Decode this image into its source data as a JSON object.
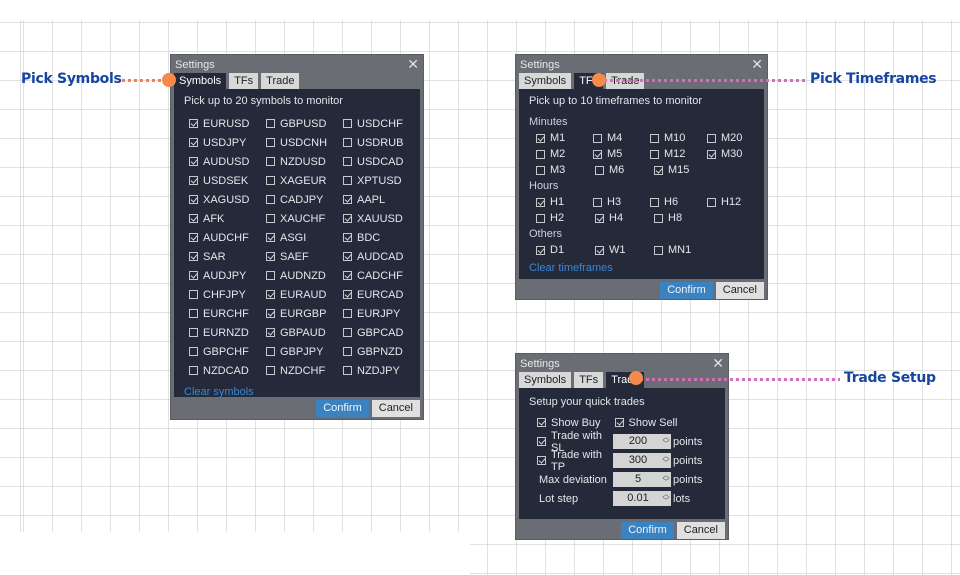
{
  "callouts": {
    "symbols": "Pick Symbols",
    "timeframes": "Pick Timeframes",
    "trade": "Trade Setup"
  },
  "colors": {
    "callout_text": "#1646a0",
    "dot": "#f58a4a",
    "symbols_line": "#f0805a",
    "timeframes_line": "#d070b8",
    "trade_line": "#d070b8",
    "confirm_bg": "#3b82c0",
    "panel_bg": "#242a3a"
  },
  "dialog": {
    "title": "Settings",
    "close_icon": "close-icon",
    "tabs": [
      "Symbols",
      "TFs",
      "Trade"
    ],
    "confirm": "Confirm",
    "cancel": "Cancel"
  },
  "symbols_dialog": {
    "active_tab": "Symbols",
    "instruction": "Pick up to 20 symbols to monitor",
    "rows": [
      [
        {
          "label": "EURUSD",
          "checked": true
        },
        {
          "label": "GBPUSD",
          "checked": false
        },
        {
          "label": "USDCHF",
          "checked": false
        }
      ],
      [
        {
          "label": "USDJPY",
          "checked": true
        },
        {
          "label": "USDCNH",
          "checked": false
        },
        {
          "label": "USDRUB",
          "checked": false
        }
      ],
      [
        {
          "label": "AUDUSD",
          "checked": true
        },
        {
          "label": "NZDUSD",
          "checked": false
        },
        {
          "label": "USDCAD",
          "checked": false
        }
      ],
      [
        {
          "label": "USDSEK",
          "checked": true
        },
        {
          "label": "XAGEUR",
          "checked": false
        },
        {
          "label": "XPTUSD",
          "checked": false
        }
      ],
      [
        {
          "label": "XAGUSD",
          "checked": true
        },
        {
          "label": "CADJPY",
          "checked": false
        },
        {
          "label": "AAPL",
          "checked": true
        }
      ],
      [
        {
          "label": "AFK",
          "checked": true
        },
        {
          "label": "XAUCHF",
          "checked": false
        },
        {
          "label": "XAUUSD",
          "checked": true
        }
      ],
      [
        {
          "label": "AUDCHF",
          "checked": true
        },
        {
          "label": "ASGI",
          "checked": true
        },
        {
          "label": "BDC",
          "checked": true
        }
      ],
      [
        {
          "label": "SAR",
          "checked": true
        },
        {
          "label": "SAEF",
          "checked": true
        },
        {
          "label": "AUDCAD",
          "checked": true
        }
      ],
      [
        {
          "label": "AUDJPY",
          "checked": true
        },
        {
          "label": "AUDNZD",
          "checked": false
        },
        {
          "label": "CADCHF",
          "checked": true
        }
      ],
      [
        {
          "label": "CHFJPY",
          "checked": false
        },
        {
          "label": "EURAUD",
          "checked": true
        },
        {
          "label": "EURCAD",
          "checked": true
        }
      ],
      [
        {
          "label": "EURCHF",
          "checked": false
        },
        {
          "label": "EURGBP",
          "checked": true
        },
        {
          "label": "EURJPY",
          "checked": false
        }
      ],
      [
        {
          "label": "EURNZD",
          "checked": false
        },
        {
          "label": "GBPAUD",
          "checked": true
        },
        {
          "label": "GBPCAD",
          "checked": false
        }
      ],
      [
        {
          "label": "GBPCHF",
          "checked": false
        },
        {
          "label": "GBPJPY",
          "checked": false
        },
        {
          "label": "GBPNZD",
          "checked": false
        }
      ],
      [
        {
          "label": "NZDCAD",
          "checked": false
        },
        {
          "label": "NZDCHF",
          "checked": false
        },
        {
          "label": "NZDJPY",
          "checked": false
        }
      ]
    ],
    "clear_link": "Clear symbols"
  },
  "tfs_dialog": {
    "active_tab": "TFs",
    "instruction": "Pick up to 10 timeframes to monitor",
    "groups": [
      {
        "label": "Minutes",
        "rows": [
          [
            {
              "label": "M1",
              "checked": true
            },
            {
              "label": "M4",
              "checked": false
            },
            {
              "label": "M10",
              "checked": false
            },
            {
              "label": "M20",
              "checked": false
            }
          ],
          [
            {
              "label": "M2",
              "checked": false
            },
            {
              "label": "M5",
              "checked": true
            },
            {
              "label": "M12",
              "checked": false
            },
            {
              "label": "M30",
              "checked": true
            }
          ],
          [
            {
              "label": "M3",
              "checked": false
            },
            {
              "label": "M6",
              "checked": false
            },
            {
              "label": "M15",
              "checked": true
            }
          ]
        ]
      },
      {
        "label": "Hours",
        "rows": [
          [
            {
              "label": "H1",
              "checked": true
            },
            {
              "label": "H3",
              "checked": false
            },
            {
              "label": "H6",
              "checked": false
            },
            {
              "label": "H12",
              "checked": false
            }
          ],
          [
            {
              "label": "H2",
              "checked": false
            },
            {
              "label": "H4",
              "checked": true
            },
            {
              "label": "H8",
              "checked": false
            }
          ]
        ]
      },
      {
        "label": "Others",
        "rows": [
          [
            {
              "label": "D1",
              "checked": true
            },
            {
              "label": "W1",
              "checked": true
            },
            {
              "label": "MN1",
              "checked": false
            }
          ]
        ]
      }
    ],
    "clear_link": "Clear timeframes"
  },
  "trade_dialog": {
    "active_tab": "Trade",
    "instruction": "Setup your quick trades",
    "show_buy": {
      "label": "Show Buy",
      "checked": true
    },
    "show_sell": {
      "label": "Show Sell",
      "checked": true
    },
    "fields": [
      {
        "label": "Trade with SL",
        "has_checkbox": true,
        "checked": true,
        "value": "200",
        "unit": "points"
      },
      {
        "label": "Trade with TP",
        "has_checkbox": true,
        "checked": true,
        "value": "300",
        "unit": "points"
      },
      {
        "label": "Max deviation",
        "has_checkbox": false,
        "value": "5",
        "unit": "points"
      },
      {
        "label": "Lot step",
        "has_checkbox": false,
        "value": "0.01",
        "unit": "lots"
      }
    ]
  }
}
